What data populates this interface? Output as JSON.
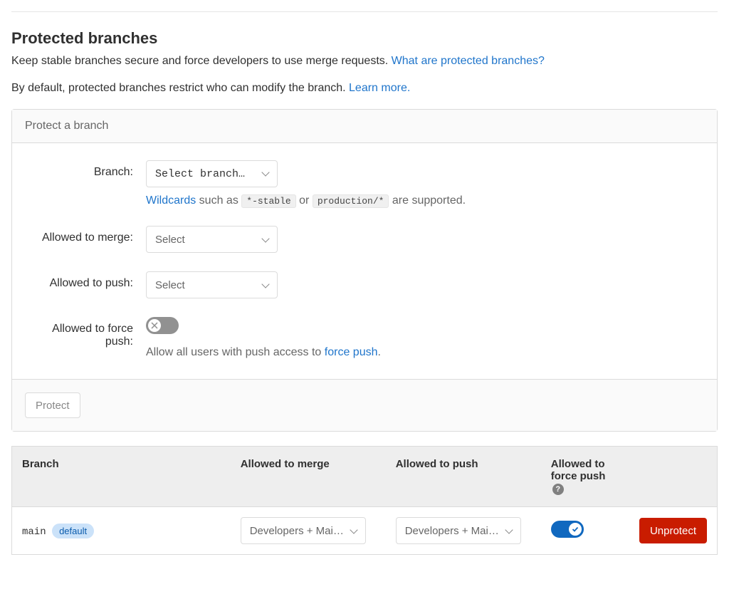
{
  "title": "Protected branches",
  "intro1_pre": "Keep stable branches secure and force developers to use merge requests. ",
  "intro1_link": "What are protected branches?",
  "intro2_pre": "By default, protected branches restrict who can modify the branch. ",
  "intro2_link": "Learn more.",
  "card": {
    "header": "Protect a branch",
    "labels": {
      "branch": "Branch:",
      "allowed_merge": "Allowed to merge:",
      "allowed_push": "Allowed to push:",
      "allowed_force_push": "Allowed to force push:"
    },
    "branch_select": "Select branch…",
    "merge_select": "Select",
    "push_select": "Select",
    "hint": {
      "wildcards_link": "Wildcards",
      "text_mid1": " such as ",
      "code1": "*-stable",
      "text_mid2": " or ",
      "code2": "production/*",
      "text_end": " are supported."
    },
    "force_push_text_pre": "Allow all users with push access to ",
    "force_push_link": "force push",
    "force_push_text_post": ".",
    "protect_button": "Protect"
  },
  "table": {
    "head": {
      "branch": "Branch",
      "allowed_merge": "Allowed to merge",
      "allowed_push": "Allowed to push",
      "allowed_force_push": "Allowed to force push"
    },
    "rows": [
      {
        "name": "main",
        "badge": "default",
        "merge": "Developers + Mai…",
        "push": "Developers + Mai…",
        "force_push_on": true,
        "action": "Unprotect"
      }
    ]
  }
}
